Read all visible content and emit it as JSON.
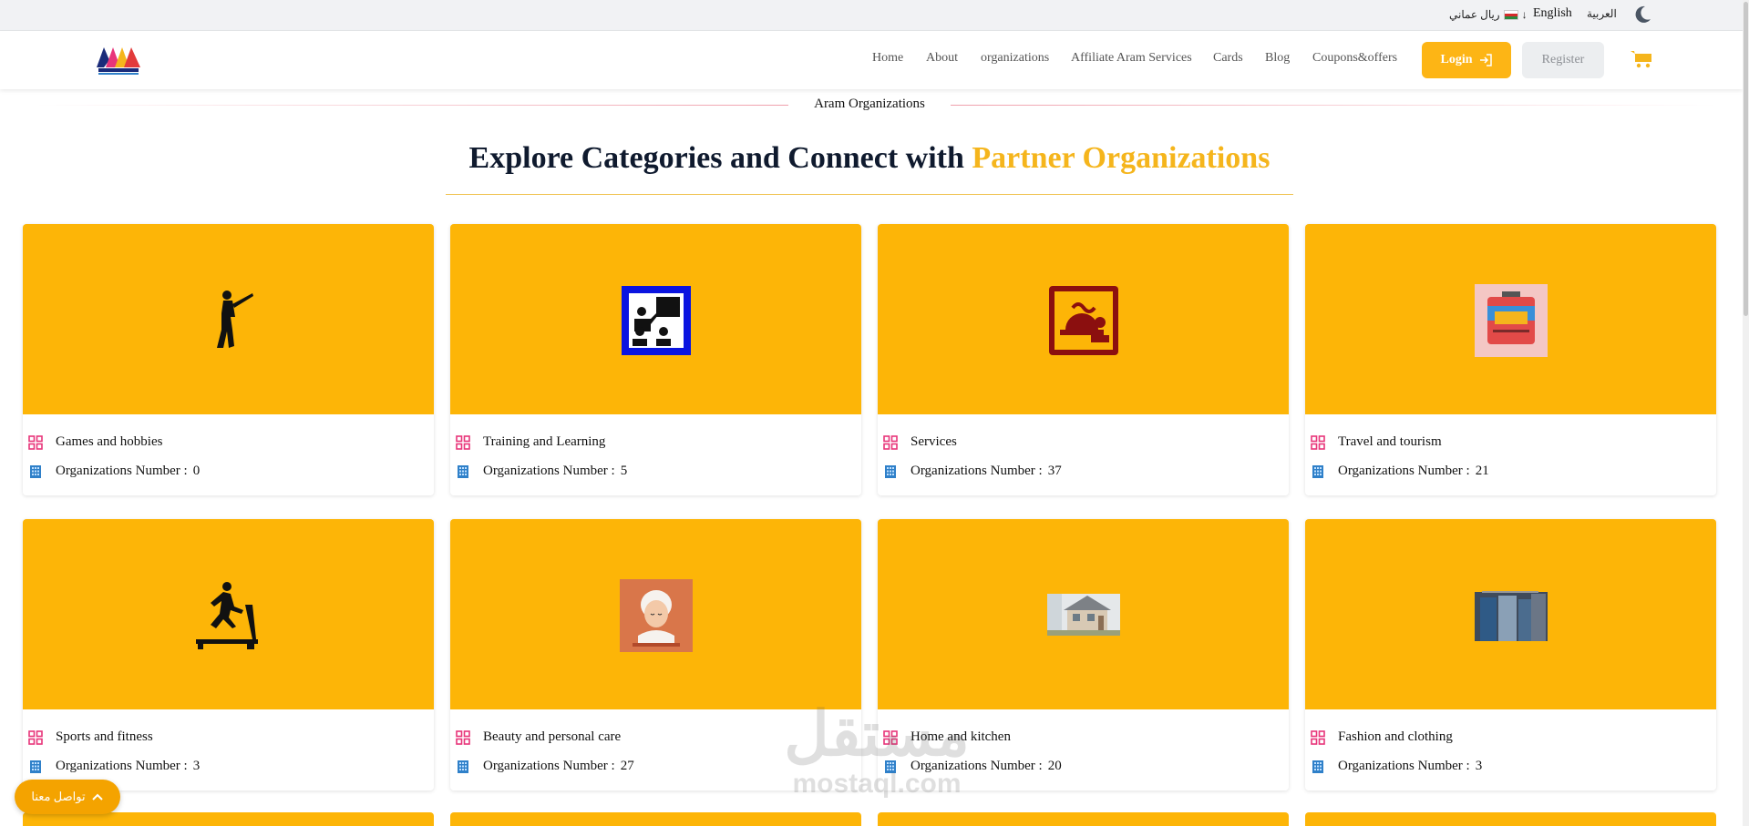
{
  "topbar": {
    "currency": "ريال عماني",
    "lang_english": "English",
    "lang_arabic": "العربية"
  },
  "nav": {
    "links": [
      "Home",
      "About",
      "organizations",
      "Affiliate Aram Services",
      "Cards",
      "Blog",
      "Coupons&offers"
    ],
    "login_label": "Login",
    "register_label": "Register"
  },
  "section": {
    "label": "Aram Organizations",
    "heading_main": "Explore Categories and Connect with ",
    "heading_accent": "Partner Organizations"
  },
  "card_count_label": "Organizations Number :",
  "categories": [
    {
      "name": "Games and hobbies",
      "count": "0",
      "icon": "golfer-icon"
    },
    {
      "name": "Training and Learning",
      "count": "5",
      "icon": "classroom-icon"
    },
    {
      "name": "Services",
      "count": "37",
      "icon": "food-service-icon"
    },
    {
      "name": "Travel and tourism",
      "count": "21",
      "icon": "suitcase-icon"
    },
    {
      "name": "Sports and fitness",
      "count": "3",
      "icon": "treadmill-icon"
    },
    {
      "name": "Beauty and personal care",
      "count": "27",
      "icon": "spa-woman-icon"
    },
    {
      "name": "Home and kitchen",
      "count": "20",
      "icon": "house-photo-icon"
    },
    {
      "name": "Fashion and clothing",
      "count": "3",
      "icon": "clothing-photo-icon"
    }
  ],
  "chat_label": "تواصل معنا",
  "watermark": {
    "ar": "مستقل",
    "en": "mostaql.com"
  },
  "colors": {
    "accent": "#fdb507",
    "heading": "#0f1a2e",
    "pink_icon": "#e8357a",
    "blue_icon": "#2f80c9"
  }
}
